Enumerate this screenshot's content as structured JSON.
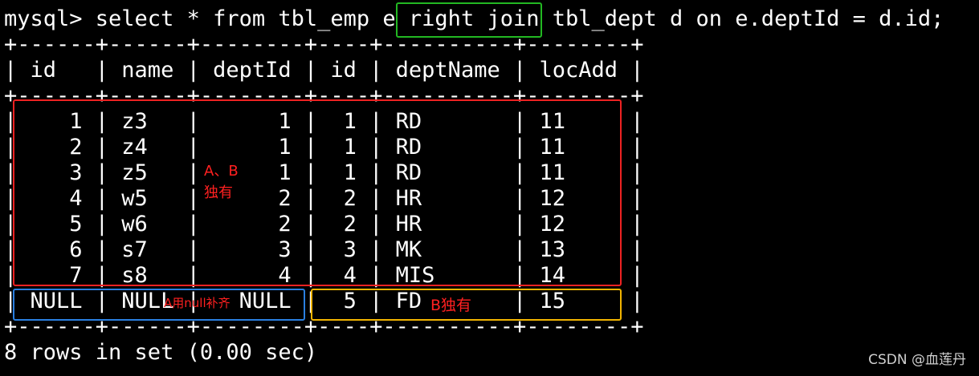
{
  "terminal": {
    "command": "mysql> select * from tbl_emp e right join tbl_dept d on e.deptId = d.id;",
    "border": "+------+------+--------+----+----------+--------+",
    "header": "| id   | name | deptId | id | deptName | locAdd |",
    "rows": [
      "|    1 | z3   |      1 |  1 | RD       | 11     |",
      "|    2 | z4   |      1 |  1 | RD       | 11     |",
      "|    3 | z5   |      1 |  1 | RD       | 11     |",
      "|    4 | w5   |      2 |  2 | HR       | 12     |",
      "|    5 | w6   |      2 |  2 | HR       | 12     |",
      "|    6 | s7   |      3 |  3 | MK       | 13     |",
      "|    7 | s8   |      4 |  4 | MIS      | 14     |",
      "| NULL | NULL |   NULL |  5 | FD       | 15     |"
    ],
    "summary": "8 rows in set (0.00 sec)"
  },
  "annotations": {
    "ab_line1": "A、B",
    "ab_line2": "独有",
    "a_null": "A用null补齐",
    "b_only": "B独有"
  },
  "watermark": "CSDN @血莲丹",
  "colors": {
    "green": "#22b822",
    "red": "#ee2222",
    "blue": "#2a7fe0",
    "orange": "#f2b400",
    "note_red": "#ff2020"
  }
}
